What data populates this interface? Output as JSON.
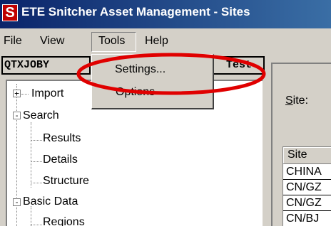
{
  "window": {
    "icon_letter": "S",
    "title": "ETE Snitcher Asset Management - Sites"
  },
  "menubar": {
    "items": [
      "File",
      "View",
      "Tools",
      "Help"
    ]
  },
  "toolbar": {
    "left_combo_value": "QTXJOBY",
    "right_combo_value": "Test"
  },
  "dropdown": {
    "items": [
      "Settings...",
      "Options"
    ]
  },
  "tree": {
    "nodes": [
      {
        "label": "Import",
        "expander": "+"
      },
      {
        "label": "Search",
        "expander": "-"
      },
      {
        "label": "Results"
      },
      {
        "label": "Details"
      },
      {
        "label": "Structure"
      },
      {
        "label": "Basic Data",
        "expander": "-"
      },
      {
        "label": "Regions"
      }
    ]
  },
  "right": {
    "site_label_accel": "S",
    "site_label_rest": "ite:",
    "grid_header": "Site",
    "grid_rows": [
      "CHINA",
      "CN/GZ",
      "CN/GZ",
      "CN/BJ"
    ]
  },
  "colors": {
    "annotation": "#e00000",
    "titlebar": "#0a246a",
    "app_icon": "#c00000"
  },
  "icons": {
    "app": "app-logo-icon",
    "expander_plus": "plus-box-icon",
    "expander_minus": "minus-box-icon"
  }
}
